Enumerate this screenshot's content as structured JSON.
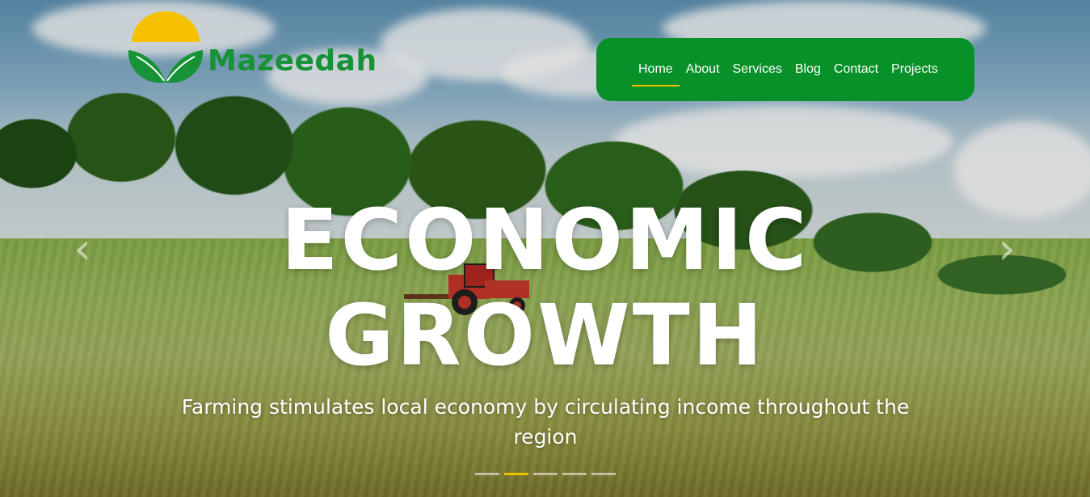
{
  "brand": {
    "name": "Mazeedah",
    "logo_icon": "sun-leaves-logo"
  },
  "nav": {
    "items": [
      {
        "label": "Home",
        "active": true
      },
      {
        "label": "About",
        "active": false
      },
      {
        "label": "Services",
        "active": false
      },
      {
        "label": "Blog",
        "active": false
      },
      {
        "label": "Contact",
        "active": false
      },
      {
        "label": "Projects",
        "active": false
      }
    ]
  },
  "carousel": {
    "headline_line1": "ECONOMIC",
    "headline_line2": "GROWTH",
    "subtitle": "Farming stimulates local economy by circulating income throughout the region",
    "prev_icon": "chevron-left-icon",
    "next_icon": "chevron-right-icon",
    "prev_glyph": "‹",
    "next_glyph": "›",
    "slide_count": 5,
    "active_slide": 2
  },
  "colors": {
    "nav_bg": "#079128",
    "accent": "#f2c100",
    "logo_green": "#179236",
    "logo_sun": "#f6c200"
  }
}
